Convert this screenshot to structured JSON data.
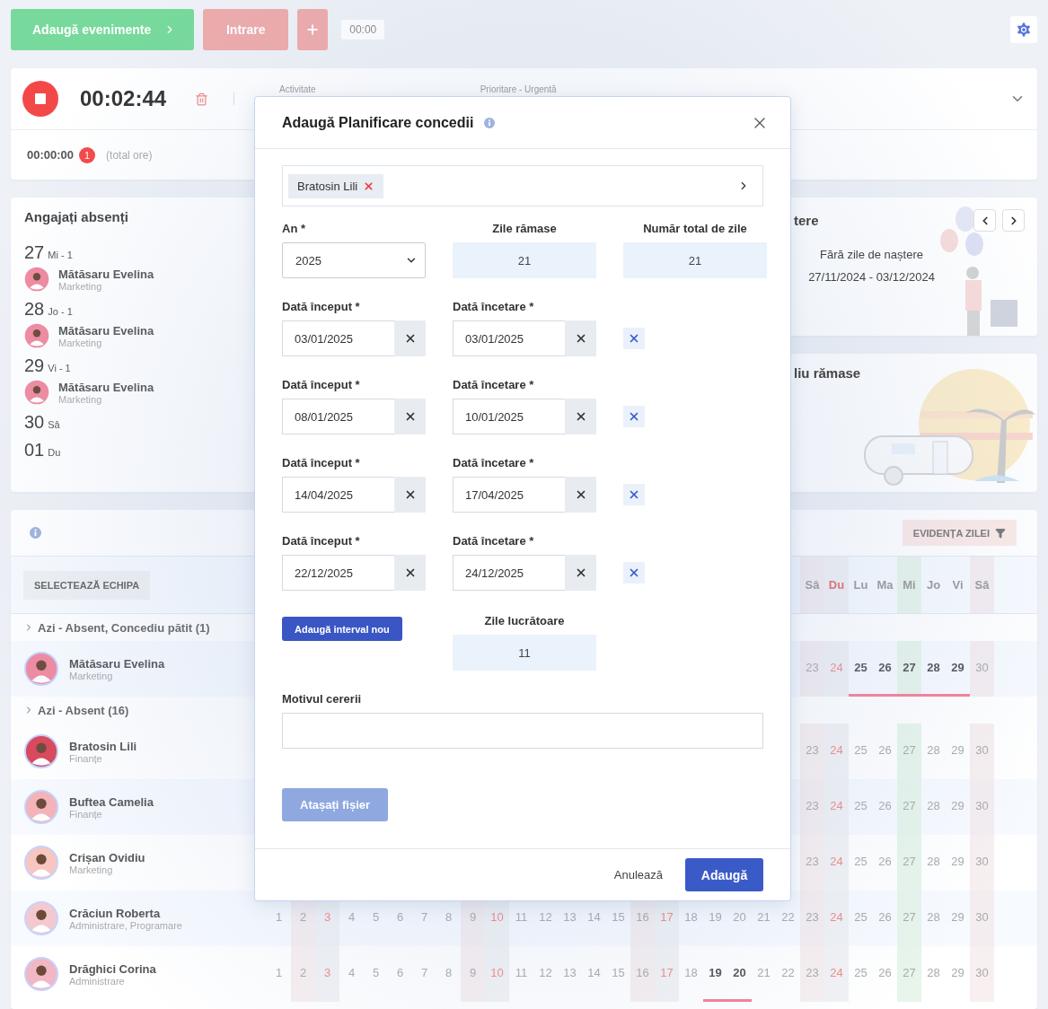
{
  "toolbar": {
    "add_events": "Adaugă evenimente",
    "check_in": "Intrare",
    "time": "00:00"
  },
  "timer": {
    "elapsed": "00:02:44",
    "activity_label": "Activitate",
    "priority_label": "Prioritare - Urgentă",
    "total": "00:00:00",
    "count": "1",
    "total_note": "(total ore)"
  },
  "absent_card": {
    "title": "Angajați absenți",
    "days": [
      {
        "day": "27",
        "weekday": "Mi - 1",
        "people": [
          {
            "name": "Mătăsaru Evelina",
            "department": "Marketing"
          }
        ]
      },
      {
        "day": "28",
        "weekday": "Jo - 1",
        "people": [
          {
            "name": "Mătăsaru Evelina",
            "department": "Marketing"
          }
        ]
      },
      {
        "day": "29",
        "weekday": "Vi - 1",
        "people": [
          {
            "name": "Mătăsaru Evelina",
            "department": "Marketing"
          }
        ]
      },
      {
        "day": "30",
        "weekday": "Sâ"
      },
      {
        "day": "01",
        "weekday": "Du"
      }
    ]
  },
  "birthdays": {
    "title": "tere",
    "message": "Fără zile de naștere",
    "range": "27/11/2024 - 03/12/2024"
  },
  "vacation": {
    "title": "liu rămase"
  },
  "schedule": {
    "filter_button": "EVIDENȚA ZILEI",
    "team_button": "SELECTEAZĂ ECHIPA",
    "weekdays": [
      {
        "label": "Sâ",
        "kind": "saturday"
      },
      {
        "label": "Du",
        "kind": "sunday"
      },
      {
        "label": "Lu",
        "kind": "weekday"
      },
      {
        "label": "Ma",
        "kind": "weekday"
      },
      {
        "label": "Mi",
        "kind": "today"
      },
      {
        "label": "Jo",
        "kind": "weekday"
      },
      {
        "label": "Vi",
        "kind": "weekday"
      },
      {
        "label": "Sâ",
        "kind": "saturday"
      }
    ],
    "groups": [
      {
        "title": "Azi - Absent, Concediu pătit (1)",
        "rows": [
          {
            "name": "Mătăsaru Evelina",
            "department": "Marketing",
            "days": [
              {
                "label": "23",
                "kind": "saturday",
                "marked": false
              },
              {
                "label": "24",
                "kind": "sunday",
                "marked": false
              },
              {
                "label": "25",
                "kind": "weekday",
                "marked": true
              },
              {
                "label": "26",
                "kind": "weekday",
                "marked": true
              },
              {
                "label": "27",
                "kind": "today",
                "marked": true
              },
              {
                "label": "28",
                "kind": "weekday",
                "marked": true
              },
              {
                "label": "29",
                "kind": "weekday",
                "marked": true
              },
              {
                "label": "30",
                "kind": "saturday",
                "marked": false
              }
            ]
          }
        ]
      },
      {
        "title": "Azi - Absent (16)",
        "rows": [
          {
            "name": "Bratosin Lili",
            "department": "Finanțe",
            "days": [
              {
                "label": "23",
                "kind": "saturday",
                "marked": false
              },
              {
                "label": "24",
                "kind": "sunday",
                "marked": false
              },
              {
                "label": "25",
                "kind": "weekday",
                "marked": false
              },
              {
                "label": "26",
                "kind": "weekday",
                "marked": false
              },
              {
                "label": "27",
                "kind": "today",
                "marked": false
              },
              {
                "label": "28",
                "kind": "weekday",
                "marked": false
              },
              {
                "label": "29",
                "kind": "weekday",
                "marked": false
              },
              {
                "label": "30",
                "kind": "saturday",
                "marked": false
              }
            ]
          },
          {
            "name": "Buftea Camelia",
            "department": "Finanțe",
            "days": [
              {
                "label": "23",
                "kind": "saturday",
                "marked": false
              },
              {
                "label": "24",
                "kind": "sunday",
                "marked": false
              },
              {
                "label": "25",
                "kind": "weekday",
                "marked": false
              },
              {
                "label": "26",
                "kind": "weekday",
                "marked": false
              },
              {
                "label": "27",
                "kind": "today",
                "marked": false
              },
              {
                "label": "28",
                "kind": "weekday",
                "marked": false
              },
              {
                "label": "29",
                "kind": "weekday",
                "marked": false
              },
              {
                "label": "30",
                "kind": "saturday",
                "marked": false
              }
            ]
          },
          {
            "name": "Crișan Ovidiu",
            "department": "Marketing",
            "days": [
              {
                "label": "23",
                "kind": "saturday",
                "marked": false
              },
              {
                "label": "24",
                "kind": "sunday",
                "marked": false
              },
              {
                "label": "25",
                "kind": "weekday",
                "marked": false
              },
              {
                "label": "26",
                "kind": "weekday",
                "marked": false
              },
              {
                "label": "27",
                "kind": "today",
                "marked": false
              },
              {
                "label": "28",
                "kind": "weekday",
                "marked": false
              },
              {
                "label": "29",
                "kind": "weekday",
                "marked": false
              },
              {
                "label": "30",
                "kind": "saturday",
                "marked": false
              }
            ]
          },
          {
            "name": "Crăciun Roberta",
            "department": "Administrare, Programare",
            "days": [
              {
                "label": "1",
                "kind": "weekday",
                "marked": false
              },
              {
                "label": "2",
                "kind": "saturday",
                "marked": false
              },
              {
                "label": "3",
                "kind": "sunday",
                "marked": false
              },
              {
                "label": "4",
                "kind": "weekday",
                "marked": false
              },
              {
                "label": "5",
                "kind": "weekday",
                "marked": false
              },
              {
                "label": "6",
                "kind": "weekday",
                "marked": false
              },
              {
                "label": "7",
                "kind": "weekday",
                "marked": false
              },
              {
                "label": "8",
                "kind": "weekday",
                "marked": false
              },
              {
                "label": "9",
                "kind": "saturday",
                "marked": false
              },
              {
                "label": "10",
                "kind": "sunday",
                "marked": false
              },
              {
                "label": "11",
                "kind": "weekday",
                "marked": false
              },
              {
                "label": "12",
                "kind": "weekday",
                "marked": false
              },
              {
                "label": "13",
                "kind": "weekday",
                "marked": false
              },
              {
                "label": "14",
                "kind": "weekday",
                "marked": false
              },
              {
                "label": "15",
                "kind": "weekday",
                "marked": false
              },
              {
                "label": "16",
                "kind": "saturday",
                "marked": false
              },
              {
                "label": "17",
                "kind": "sunday",
                "marked": false
              },
              {
                "label": "18",
                "kind": "weekday",
                "marked": false
              },
              {
                "label": "19",
                "kind": "weekday",
                "marked": false
              },
              {
                "label": "20",
                "kind": "weekday",
                "marked": false
              },
              {
                "label": "21",
                "kind": "weekday",
                "marked": false
              },
              {
                "label": "22",
                "kind": "weekday",
                "marked": false
              },
              {
                "label": "23",
                "kind": "saturday",
                "marked": false
              },
              {
                "label": "24",
                "kind": "sunday",
                "marked": false
              },
              {
                "label": "25",
                "kind": "weekday",
                "marked": false
              },
              {
                "label": "26",
                "kind": "weekday",
                "marked": false
              },
              {
                "label": "27",
                "kind": "today",
                "marked": false
              },
              {
                "label": "28",
                "kind": "weekday",
                "marked": false
              },
              {
                "label": "29",
                "kind": "weekday",
                "marked": false
              },
              {
                "label": "30",
                "kind": "saturday",
                "marked": false
              }
            ]
          },
          {
            "name": "Drăghici Corina",
            "department": "Administrare",
            "days": [
              {
                "label": "1",
                "kind": "weekday",
                "marked": false
              },
              {
                "label": "2",
                "kind": "saturday",
                "marked": false
              },
              {
                "label": "3",
                "kind": "sunday",
                "marked": false
              },
              {
                "label": "4",
                "kind": "weekday",
                "marked": false
              },
              {
                "label": "5",
                "kind": "weekday",
                "marked": false
              },
              {
                "label": "6",
                "kind": "weekday",
                "marked": false
              },
              {
                "label": "7",
                "kind": "weekday",
                "marked": false
              },
              {
                "label": "8",
                "kind": "weekday",
                "marked": false
              },
              {
                "label": "9",
                "kind": "saturday",
                "marked": false
              },
              {
                "label": "10",
                "kind": "sunday",
                "marked": false
              },
              {
                "label": "11",
                "kind": "weekday",
                "marked": false
              },
              {
                "label": "12",
                "kind": "weekday",
                "marked": false
              },
              {
                "label": "13",
                "kind": "weekday",
                "marked": false
              },
              {
                "label": "14",
                "kind": "weekday",
                "marked": false
              },
              {
                "label": "15",
                "kind": "weekday",
                "marked": false
              },
              {
                "label": "16",
                "kind": "saturday",
                "marked": false
              },
              {
                "label": "17",
                "kind": "sunday",
                "marked": false
              },
              {
                "label": "18",
                "kind": "weekday",
                "marked": false
              },
              {
                "label": "19",
                "kind": "weekday",
                "marked": true
              },
              {
                "label": "20",
                "kind": "weekday",
                "marked": true
              },
              {
                "label": "21",
                "kind": "weekday",
                "marked": false
              },
              {
                "label": "22",
                "kind": "weekday",
                "marked": false
              },
              {
                "label": "23",
                "kind": "saturday",
                "marked": false
              },
              {
                "label": "24",
                "kind": "sunday",
                "marked": false
              },
              {
                "label": "25",
                "kind": "weekday",
                "marked": false
              },
              {
                "label": "26",
                "kind": "weekday",
                "marked": false
              },
              {
                "label": "27",
                "kind": "today",
                "marked": false
              },
              {
                "label": "28",
                "kind": "weekday",
                "marked": false
              },
              {
                "label": "29",
                "kind": "weekday",
                "marked": false
              },
              {
                "label": "30",
                "kind": "saturday",
                "marked": false
              }
            ]
          }
        ]
      }
    ]
  },
  "modal": {
    "title": "Adaugă Planificare concedii",
    "employee_chip": "Bratosin Lili",
    "year_label": "An *",
    "year": "2025",
    "remaining_label": "Zile rămase",
    "remaining": "21",
    "total_label": "Număr total de zile",
    "total": "21",
    "intervals": [
      {
        "start_label": "Dată început *",
        "start": "03/01/2025",
        "end_label": "Dată încetare *",
        "end": "03/01/2025"
      },
      {
        "start_label": "Dată început *",
        "start": "08/01/2025",
        "end_label": "Dată încetare *",
        "end": "10/01/2025"
      },
      {
        "start_label": "Dată început *",
        "start": "14/04/2025",
        "end_label": "Dată încetare *",
        "end": "17/04/2025"
      },
      {
        "start_label": "Dată început *",
        "start": "22/12/2025",
        "end_label": "Dată încetare *",
        "end": "24/12/2025"
      }
    ],
    "add_interval": "Adaugă interval nou",
    "working_label": "Zile lucrătoare",
    "working": "11",
    "reason_label": "Motivul cererii",
    "attach": "Atașați fișier",
    "cancel": "Anulează",
    "submit": "Adaugă"
  }
}
